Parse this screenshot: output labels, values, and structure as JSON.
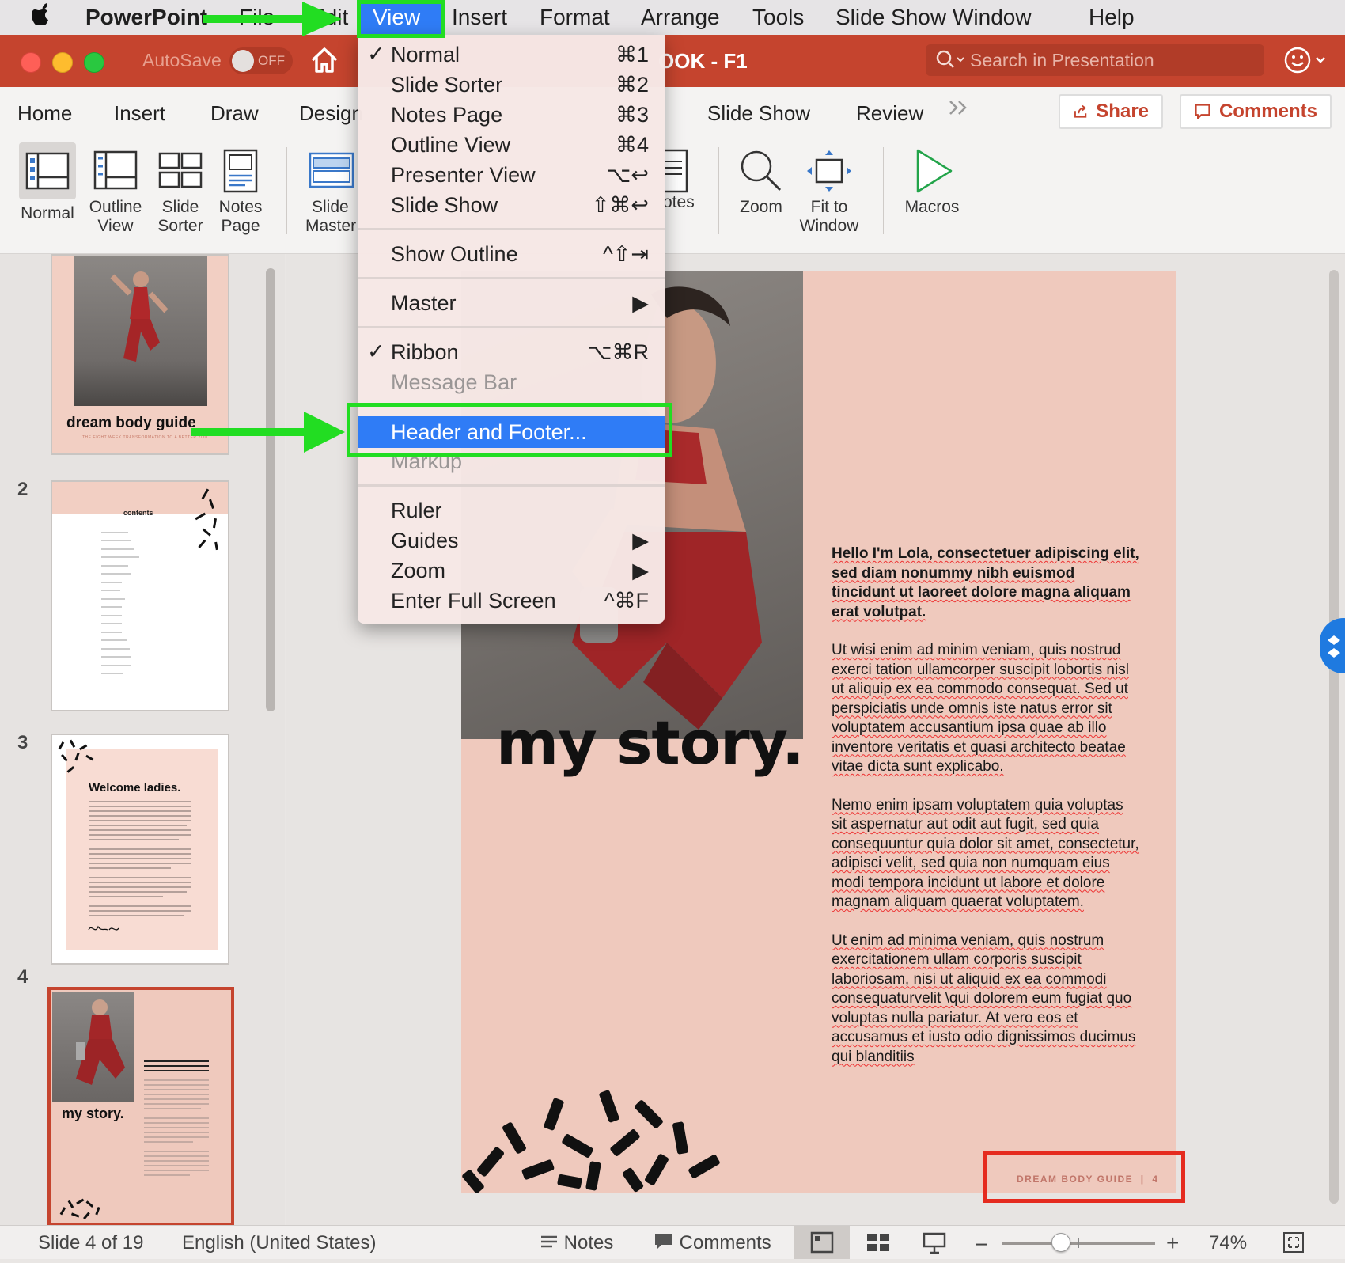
{
  "menubar": {
    "app": "PowerPoint",
    "items": [
      "File",
      "Edit",
      "View",
      "Insert",
      "Format",
      "Arrange",
      "Tools",
      "Slide Show",
      "Window",
      "Help"
    ],
    "active": "View"
  },
  "titlebar": {
    "autosave_label": "AutoSave",
    "autosave_state": "OFF",
    "doc_title_fragment": "OOK - F1",
    "search_placeholder": "Search in Presentation"
  },
  "ribbon_tabs": [
    "Home",
    "Insert",
    "Draw",
    "Design",
    "Slide Show",
    "Review"
  ],
  "share_label": "Share",
  "comments_label": "Comments",
  "ribbon": {
    "normal": "Normal",
    "outline_view": [
      "Outline",
      "View"
    ],
    "slide_sorter": [
      "Slide",
      "Sorter"
    ],
    "notes_page": [
      "Notes",
      "Page"
    ],
    "slide_master": [
      "Slide",
      "Master"
    ],
    "notes_fragment": "otes",
    "zoom": "Zoom",
    "fit_to_window": [
      "Fit to",
      "Window"
    ],
    "macros": "Macros"
  },
  "view_menu": {
    "normal": {
      "label": "Normal",
      "shortcut": "⌘1",
      "checked": true
    },
    "slide_sorter": {
      "label": "Slide Sorter",
      "shortcut": "⌘2"
    },
    "notes_page": {
      "label": "Notes Page",
      "shortcut": "⌘3"
    },
    "outline_view": {
      "label": "Outline View",
      "shortcut": "⌘4"
    },
    "presenter_view": {
      "label": "Presenter View",
      "shortcut": "⌥↩"
    },
    "slide_show": {
      "label": "Slide Show",
      "shortcut": "⇧⌘↩"
    },
    "show_outline": {
      "label": "Show Outline",
      "shortcut": "^⇧⇥"
    },
    "master": {
      "label": "Master"
    },
    "ribbon": {
      "label": "Ribbon",
      "shortcut": "⌥⌘R",
      "checked": true
    },
    "message_bar": {
      "label": "Message Bar",
      "disabled": true
    },
    "header_footer": {
      "label": "Header and Footer...",
      "highlighted": true
    },
    "markup": {
      "label": "Markup",
      "disabled": true
    },
    "ruler": {
      "label": "Ruler"
    },
    "guides": {
      "label": "Guides"
    },
    "zoom": {
      "label": "Zoom"
    },
    "full_screen": {
      "label": "Enter Full Screen",
      "shortcut": "^⌘F"
    }
  },
  "thumbnails": {
    "slide1_title": "dream body guide",
    "slide1_sub": "THE EIGHT WEEK TRANSFORMATION TO A BETTER YOU",
    "slide2_num": "2",
    "slide2_title": "contents",
    "slide3_num": "3",
    "slide3_title": "Welcome ladies.",
    "slide4_num": "4",
    "slide4_title": "my story."
  },
  "slide": {
    "heading": "my story.",
    "para1": "Hello I'm Lola, consectetuer adipiscing elit, sed diam nonummy nibh euismod tincidunt ut laoreet dolore magna aliquam erat volutpat.",
    "para2": "Ut wisi enim ad minim veniam, quis nostrud exerci tation ullamcorper suscipit lobortis nisl ut aliquip ex ea commodo consequat. Sed ut perspiciatis unde omnis iste natus error sit voluptatem accusantium ipsa quae ab illo inventore veritatis et quasi architecto beatae vitae dicta sunt explicabo.",
    "para3": "Nemo enim ipsam voluptatem quia voluptas sit aspernatur aut odit aut fugit, sed quia consequuntur quia dolor sit amet, consectetur, adipisci velit, sed quia non numquam eius modi tempora incidunt ut labore et dolore magnam aliquam quaerat voluptatem.",
    "para4": "Ut enim ad minima veniam, quis nostrum exercitationem ullam corporis suscipit laboriosam, nisi ut aliquid ex ea commodi consequaturvelit \\qui dolorem eum fugiat quo voluptas nulla pariatur. At vero eos et accusamus et iusto odio dignissimos ducimus qui blanditiis",
    "footer": "DREAM BODY GUIDE  |  4"
  },
  "statusbar": {
    "slide_info": "Slide 4 of 19",
    "language": "English (United States)",
    "notes": "Notes",
    "comments": "Comments",
    "zoom": "74%",
    "zoom_fraction": 0.38
  },
  "colors": {
    "titlebar": "#c5442e",
    "slide_bg": "#efc9bd",
    "annotation_green": "#22dd22",
    "annotation_red": "#e52b1f",
    "menu_highlight": "#2f7cf6"
  }
}
